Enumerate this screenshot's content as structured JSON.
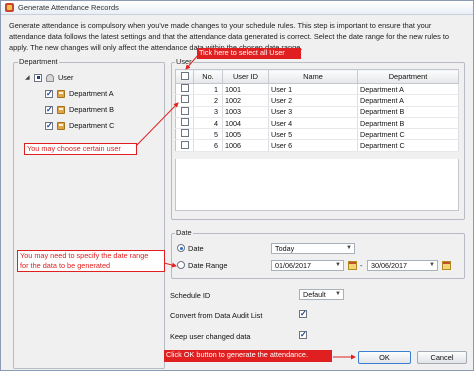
{
  "window": {
    "title": "Generate Attendance Records",
    "intro": "Generate attendance is compulsory when you've made changes to your schedule rules. This step is important to ensure that your attendance data follows the latest settings and that the attendance data generated is correct. Select the date range for the new rules to apply. The new changes will only affect the attendance data within the chosen date range."
  },
  "department": {
    "label": "Department",
    "root": "User",
    "items": [
      "Department A",
      "Department B",
      "Department C"
    ]
  },
  "user": {
    "label": "User",
    "columns": [
      "No.",
      "User ID",
      "Name",
      "Department"
    ],
    "rows": [
      {
        "no": "1",
        "id": "1001",
        "name": "User 1",
        "dept": "Department A"
      },
      {
        "no": "2",
        "id": "1002",
        "name": "User 2",
        "dept": "Department A"
      },
      {
        "no": "3",
        "id": "1003",
        "name": "User 3",
        "dept": "Department B"
      },
      {
        "no": "4",
        "id": "1004",
        "name": "User 4",
        "dept": "Department B"
      },
      {
        "no": "5",
        "id": "1005",
        "name": "User 5",
        "dept": "Department C"
      },
      {
        "no": "6",
        "id": "1006",
        "name": "User 6",
        "dept": "Department C"
      }
    ]
  },
  "date": {
    "label": "Date",
    "option_date": "Date",
    "option_range": "Date Range",
    "date_value": "Today",
    "range_from": "01/06/2017",
    "range_sep": "-",
    "range_to": "30/06/2017"
  },
  "options": {
    "schedule_label": "Schedule ID",
    "schedule_value": "Default",
    "convert_label": "Convert from Data Audit List",
    "keep_label": "Keep user changed data"
  },
  "buttons": {
    "ok": "OK",
    "cancel": "Cancel"
  },
  "annotations": {
    "select_all": "Tick here to select all User",
    "choose_user": "You may choose certain user",
    "date_range_line1": "You may need to specify the date range",
    "date_range_line2": "for the data to be generated",
    "ok_hint": "Click OK button to generate the attendance."
  },
  "colors": {
    "annotation": "#e02020",
    "accent": "#2a6fd6"
  }
}
